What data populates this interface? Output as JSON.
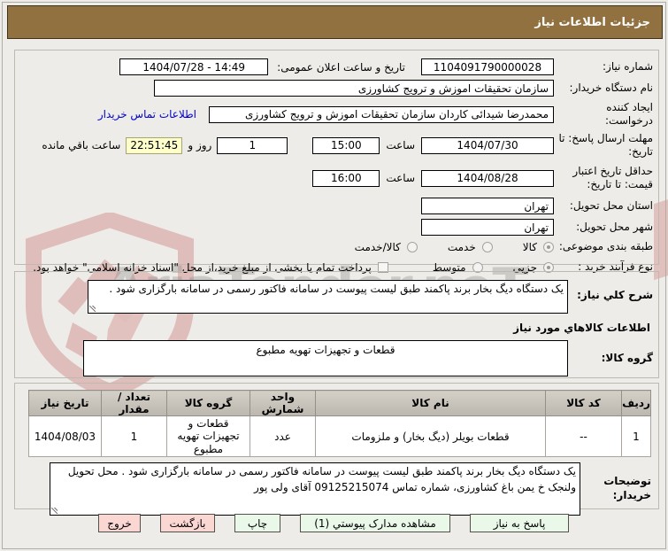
{
  "window_title": "جزئیات اطلاعات نیاز",
  "watermark": {
    "text": "AriaTender.neT"
  },
  "colors": {
    "header_bg": "#927140",
    "button_green": "#E9F8E9",
    "button_pink": "#FBD7D4",
    "countdown_bg": "#FFFFC9",
    "link_blue": "#0000CC"
  },
  "form": {
    "need_number": {
      "label": "شماره نیاز:",
      "value": "1104091790000028"
    },
    "announce": {
      "label": "تاریخ و ساعت اعلان عمومی:",
      "value": "1404/07/28 - 14:49"
    },
    "buyer_org": {
      "label": "نام دستگاه خریدار:",
      "value": "سازمان تحقیقات  اموزش و ترویج کشاورزی"
    },
    "creator": {
      "label": "ایجاد کننده درخواست:",
      "value": "محمدرضا شیدائی کاردان سازمان تحقیقات  اموزش و ترویج کشاورزی",
      "contact_link": "اطلاعات تماس خریدار"
    },
    "deadline": {
      "label": "مهلت ارسال پاسخ: تا تاریخ:",
      "date": "1404/07/30",
      "hour_label": "ساعت",
      "hour": "15:00",
      "days": "1",
      "days_label": "روز و",
      "countdown": "22:51:45",
      "remaining_label": "ساعت باقي مانده"
    },
    "price_validity": {
      "label": "حداقل تاریخ اعتبار قیمت: تا تاریخ:",
      "date": "1404/08/28",
      "hour_label": "ساعت",
      "hour": "16:00"
    },
    "province": {
      "label": "استان محل تحویل:",
      "value": "تهران"
    },
    "city": {
      "label": "شهر محل تحویل:",
      "value": "تهران"
    },
    "classification": {
      "label": "طبقه بندی موضوعی:",
      "options": [
        {
          "label": "کالا",
          "selected": true
        },
        {
          "label": "خدمت",
          "selected": false
        },
        {
          "label": "کالا/خدمت",
          "selected": false
        }
      ]
    },
    "process_type": {
      "label": "نوع فرآیند خرید :",
      "options": [
        {
          "label": "جزیی",
          "selected": true
        },
        {
          "label": "متوسط",
          "selected": false
        }
      ],
      "treasury_checkbox_label": "پرداخت تمام یا بخشی از مبلغ خرید،از محل \"اسناد خزانه اسلامی\" خواهد بود."
    }
  },
  "need_description": {
    "label": "شرح کلي نیاز:",
    "value": "یک دستگاه دیگ بخار برند پاکمند طبق لیست پیوست در سامانه فاکتور رسمی در سامانه بارگزاری شود ."
  },
  "goods_section": {
    "heading": "اطلاعات کالاهاي مورد نیاز",
    "group_label": "گروه کالا:",
    "group_value": "قطعات و تجهیزات تهویه مطبوع",
    "table": {
      "headers": [
        "ردیف",
        "کد کالا",
        "نام کالا",
        "واحد شمارش",
        "گروه کالا",
        "تعداد / مقدار",
        "تاریخ نیاز"
      ],
      "rows": [
        [
          "1",
          "--",
          "قطعات بویلر (دیگ بخار) و ملزومات",
          "عدد",
          "قطعات و تجهیزات تهویه مطبوع",
          "1",
          "1404/08/03"
        ]
      ]
    }
  },
  "buyer_notes": {
    "label": "توضیحات خریدار:",
    "value": "یک دستگاه دیگ بخار برند پاکمند طبق لیست پیوست در سامانه فاکتور رسمی در سامانه بارگزاری شود . محل تحویل ولنجک خ یمن باغ کشاورزی، شماره تماس 09125215074 آقای ولی پور"
  },
  "buttons": [
    {
      "label": "پاسخ به نیاز",
      "type": "green"
    },
    {
      "label": "مشاهده مدارک پیوستي (1)",
      "type": "green"
    },
    {
      "label": "چاپ",
      "type": "green"
    },
    {
      "label": "بازگشت",
      "type": "pink"
    },
    {
      "label": "خروج",
      "type": "pink"
    }
  ]
}
